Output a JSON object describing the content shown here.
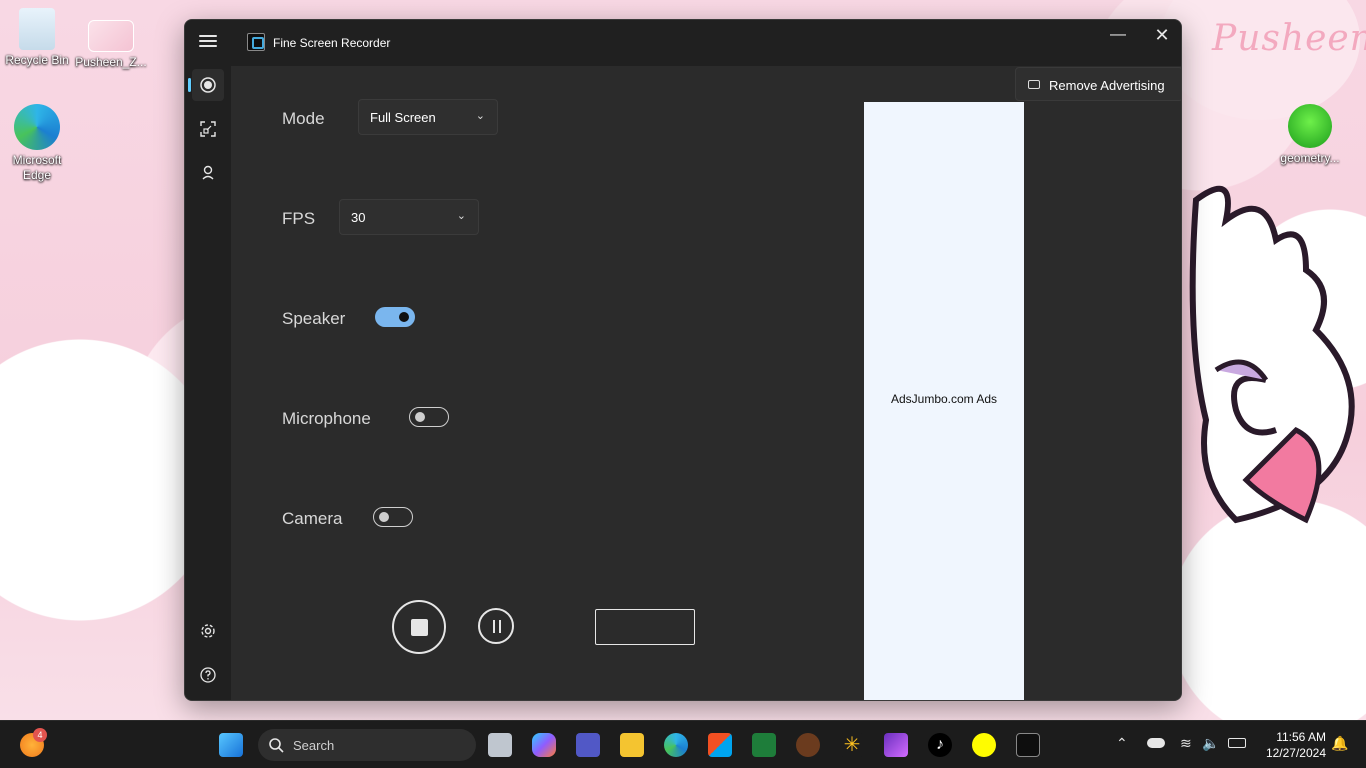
{
  "desktop": {
    "icons": [
      {
        "label": "Recycle Bin"
      },
      {
        "label": "Pusheen_Z..."
      },
      {
        "label": "Microsoft Edge"
      },
      {
        "label": "geometry..."
      }
    ],
    "wallpaper_text": "Pusheen"
  },
  "window": {
    "title": "Fine Screen Recorder",
    "minimize_glyph": "—",
    "close_glyph": "✕",
    "nav": [
      {
        "name": "record-icon",
        "active": true
      },
      {
        "name": "region-icon",
        "active": false
      },
      {
        "name": "webcam-icon",
        "active": false
      },
      {
        "name": "settings-icon",
        "active": false
      },
      {
        "name": "help-icon",
        "active": false
      }
    ]
  },
  "settings": {
    "mode_label": "Mode",
    "mode_value": "Full Screen",
    "fps_label": "FPS",
    "fps_value": "30",
    "speaker_label": "Speaker",
    "speaker_on": true,
    "microphone_label": "Microphone",
    "microphone_on": false,
    "camera_label": "Camera",
    "camera_on": false
  },
  "ads": {
    "remove_label": "Remove Advertising",
    "ad_text": "AdsJumbo.com Ads"
  },
  "taskbar": {
    "search_placeholder": "Search",
    "weather_badge": "4",
    "time": "11:56 AM",
    "date": "12/27/2024"
  },
  "colors": {
    "accent": "#60cdff",
    "toggle_on": "#7ab6ee",
    "window_bg": "#2b2b2b",
    "ad_bg": "#f0f6fe"
  }
}
